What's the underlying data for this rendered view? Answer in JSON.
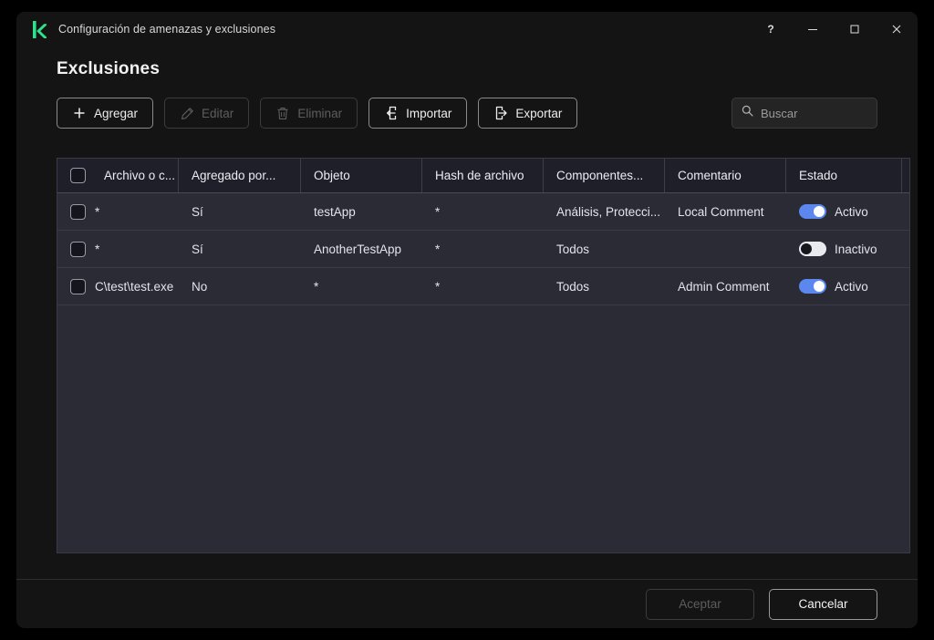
{
  "window": {
    "logo_icon": "kaspersky-k-logo",
    "logo_color": "#2FE08C",
    "title": "Configuración de amenazas y exclusiones",
    "controls": [
      {
        "name": "help",
        "glyph": "?"
      },
      {
        "name": "minimize",
        "glyph": "—"
      },
      {
        "name": "maximize",
        "glyph": "□"
      },
      {
        "name": "close",
        "glyph": "✕"
      }
    ]
  },
  "page": {
    "title": "Exclusiones"
  },
  "toolbar": {
    "buttons": [
      {
        "label": "Agregar",
        "icon": "plus-icon",
        "enabled": true
      },
      {
        "label": "Editar",
        "icon": "pencil-icon",
        "enabled": false
      },
      {
        "label": "Eliminar",
        "icon": "trash-icon",
        "enabled": false
      },
      {
        "label": "Importar",
        "icon": "import-icon",
        "enabled": true
      },
      {
        "label": "Exportar",
        "icon": "export-icon",
        "enabled": true
      }
    ],
    "search": {
      "placeholder": "Buscar",
      "value": "",
      "icon": "search-icon"
    }
  },
  "table": {
    "columns": [
      "Archivo o c...",
      "Agregado por...",
      "Objeto",
      "Hash de archivo",
      "Componentes...",
      "Comentario",
      "Estado"
    ],
    "select_all_checked": false,
    "rows": [
      {
        "checked": false,
        "file": "*",
        "added_by": "Sí",
        "object": "testApp",
        "hash": "*",
        "components": "Análisis, Protecci...",
        "comment": "Local Comment",
        "status": "Activo",
        "status_on": true
      },
      {
        "checked": false,
        "file": "*",
        "added_by": "Sí",
        "object": "AnotherTestApp",
        "hash": "*",
        "components": "Todos",
        "comment": "",
        "status": "Inactivo",
        "status_on": false
      },
      {
        "checked": false,
        "file": "C\\test\\test.exe",
        "added_by": "No",
        "object": "*",
        "hash": "*",
        "components": "Todos",
        "comment": "Admin Comment",
        "status": "Activo",
        "status_on": true
      }
    ]
  },
  "footer": {
    "accept_label": "Aceptar",
    "accept_enabled": false,
    "cancel_label": "Cancelar",
    "cancel_enabled": true
  },
  "colors": {
    "accent_toggle_on": "#5B87EF",
    "logo": "#2FE08C",
    "table_bg": "#2B2B36",
    "table_header_bg": "#1F1F2A",
    "window_bg": "#141414"
  }
}
